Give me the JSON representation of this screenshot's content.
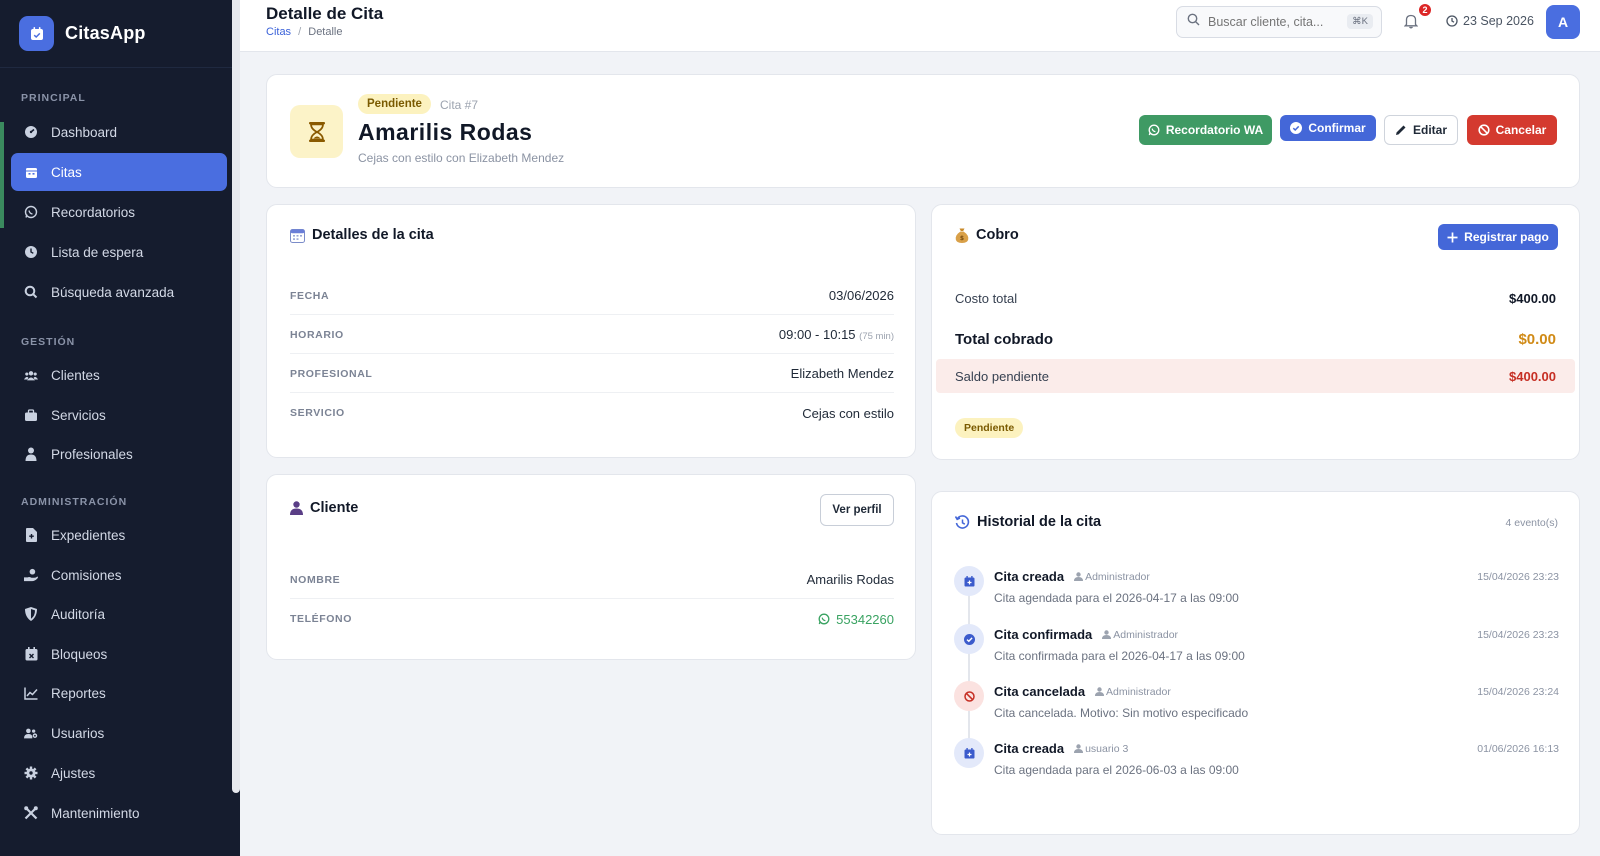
{
  "app": {
    "name": "CitasApp"
  },
  "sidebar": {
    "sections": [
      {
        "title": "PRINCIPAL",
        "items": [
          {
            "label": "Dashboard",
            "icon": "gauge-icon"
          },
          {
            "label": "Citas",
            "icon": "calendar-icon",
            "active": true
          },
          {
            "label": "Recordatorios",
            "icon": "whatsapp-icon"
          },
          {
            "label": "Lista de espera",
            "icon": "clock-icon"
          },
          {
            "label": "Búsqueda avanzada",
            "icon": "search-icon"
          }
        ]
      },
      {
        "title": "GESTIÓN",
        "items": [
          {
            "label": "Clientes",
            "icon": "users-icon"
          },
          {
            "label": "Servicios",
            "icon": "briefcase-icon"
          },
          {
            "label": "Profesionales",
            "icon": "user-tie-icon"
          }
        ]
      },
      {
        "title": "ADMINISTRACIÓN",
        "items": [
          {
            "label": "Expedientes",
            "icon": "file-medical-icon"
          },
          {
            "label": "Comisiones",
            "icon": "hand-coin-icon"
          },
          {
            "label": "Auditoría",
            "icon": "shield-icon"
          },
          {
            "label": "Bloqueos",
            "icon": "calendar-x-icon"
          },
          {
            "label": "Reportes",
            "icon": "chart-line-icon"
          },
          {
            "label": "Usuarios",
            "icon": "users-cog-icon"
          },
          {
            "label": "Ajustes",
            "icon": "gear-icon"
          },
          {
            "label": "Mantenimiento",
            "icon": "tools-icon"
          }
        ]
      }
    ]
  },
  "topbar": {
    "title": "Detalle de Cita",
    "breadcrumb": {
      "parent": "Citas",
      "separator": "/",
      "current": "Detalle"
    },
    "search": {
      "placeholder": "Buscar cliente, cita...",
      "shortcut": "⌘K"
    },
    "notifications_count": "2",
    "date": "23 Sep 2026",
    "avatar_initial": "A"
  },
  "header": {
    "status": "Pendiente",
    "cita_number": "Cita #7",
    "client_name": "Amarilis Rodas",
    "subtitle": "Cejas con estilo con Elizabeth Mendez",
    "buttons": {
      "whatsapp": "Recordatorio WA",
      "confirm": "Confirmar",
      "edit": "Editar",
      "cancel": "Cancelar"
    }
  },
  "details": {
    "title": "Detalles de la cita",
    "rows": [
      {
        "label": "FECHA",
        "value": "03/06/2026"
      },
      {
        "label": "HORARIO",
        "value": "09:00 - 10:15",
        "extra": "(75 min)"
      },
      {
        "label": "PROFESIONAL",
        "value": "Elizabeth Mendez"
      },
      {
        "label": "SERVICIO",
        "value": "Cejas con estilo"
      }
    ]
  },
  "client": {
    "title": "Cliente",
    "profile_button": "Ver perfil",
    "rows": [
      {
        "label": "NOMBRE",
        "value": "Amarilis Rodas"
      },
      {
        "label": "TELÉFONO",
        "value": "55342260"
      }
    ]
  },
  "payment": {
    "title": "Cobro",
    "register_button": "Registrar pago",
    "total_label": "Costo total",
    "total": "$400.00",
    "collected_label": "Total cobrado",
    "collected": "$0.00",
    "due_label": "Saldo pendiente",
    "due": "$400.00",
    "status": "Pendiente"
  },
  "history": {
    "title": "Historial de la cita",
    "count": "4 evento(s)",
    "events": [
      {
        "title": "Cita creada",
        "user": "Administrador",
        "time": "15/04/2026 23:23",
        "desc": "Cita agendada para el 2026-04-17 a las 09:00",
        "icon": "calendar-plus-icon",
        "tone": "blue"
      },
      {
        "title": "Cita confirmada",
        "user": "Administrador",
        "time": "15/04/2026 23:23",
        "desc": "Cita confirmada para el 2026-04-17 a las 09:00",
        "icon": "check-circle-icon",
        "tone": "blue"
      },
      {
        "title": "Cita cancelada",
        "user": "Administrador",
        "time": "15/04/2026 23:24",
        "desc": "Cita cancelada. Motivo: Sin motivo especificado",
        "icon": "ban-icon",
        "tone": "red"
      },
      {
        "title": "Cita creada",
        "user": "usuario 3",
        "time": "01/06/2026 16:13",
        "desc": "Cita agendada para el 2026-06-03 a las 09:00",
        "icon": "calendar-plus-icon",
        "tone": "blue"
      }
    ]
  },
  "colors": {
    "accent": "#4a6ee0",
    "sidebar": "#151c2e",
    "success": "#3f9a64",
    "danger": "#d43a2f",
    "warning": "#d08a16"
  }
}
